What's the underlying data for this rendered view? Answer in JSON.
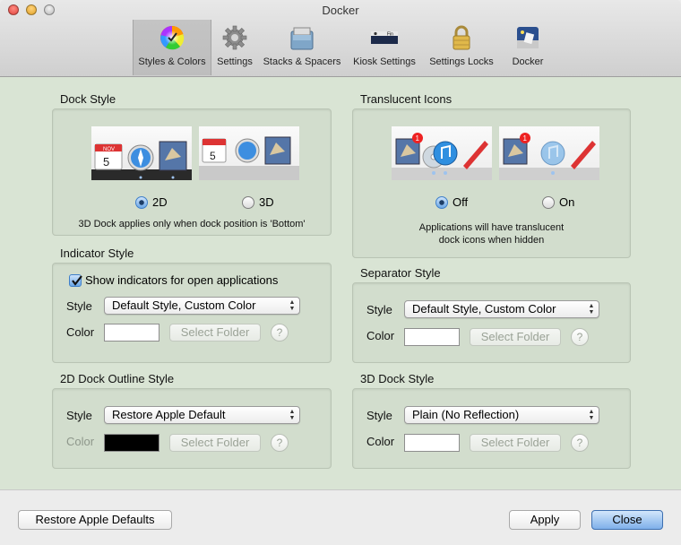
{
  "window": {
    "title": "Docker"
  },
  "toolbar": {
    "items": [
      {
        "label": "Styles & Colors",
        "icon": "color-wheel-icon",
        "selected": true
      },
      {
        "label": "Settings",
        "icon": "gear-icon",
        "selected": false
      },
      {
        "label": "Stacks & Spacers",
        "icon": "stacks-icon",
        "selected": false
      },
      {
        "label": "Kiosk Settings",
        "icon": "kiosk-menubar-icon",
        "selected": false
      },
      {
        "label": "Settings Locks",
        "icon": "padlock-icon",
        "selected": false
      },
      {
        "label": "Docker",
        "icon": "docker-app-icon",
        "selected": false
      }
    ],
    "kiosk_icon_text": "Fin"
  },
  "dock_style": {
    "title": "Dock Style",
    "options": [
      {
        "label": "2D",
        "selected": true
      },
      {
        "label": "3D",
        "selected": false
      }
    ],
    "note": "3D Dock applies only when dock position is 'Bottom'",
    "calendar_month": "NOV",
    "calendar_day": "5"
  },
  "translucent_icons": {
    "title": "Translucent Icons",
    "options": [
      {
        "label": "Off",
        "selected": true
      },
      {
        "label": "On",
        "selected": false
      }
    ],
    "note_line1": "Applications will have translucent",
    "note_line2": "dock icons when hidden",
    "badge": "1"
  },
  "indicator_style": {
    "title": "Indicator Style",
    "checkbox_label": "Show indicators for open applications",
    "checked": true,
    "style_label": "Style",
    "style_value": "Default Style, Custom Color",
    "color_label": "Color",
    "color_value": "#ffffff",
    "select_folder": "Select Folder",
    "help": "?"
  },
  "separator_style": {
    "title": "Separator Style",
    "style_label": "Style",
    "style_value": "Default Style, Custom Color",
    "color_label": "Color",
    "color_value": "#ffffff",
    "select_folder": "Select Folder",
    "help": "?"
  },
  "outline_style": {
    "title": "2D Dock Outline Style",
    "style_label": "Style",
    "style_value": "Restore Apple Default",
    "color_label": "Color",
    "color_value": "#000000",
    "select_folder": "Select Folder",
    "help": "?"
  },
  "dock3d_style": {
    "title": "3D Dock Style",
    "style_label": "Style",
    "style_value": "Plain (No Reflection)",
    "color_label": "Color",
    "color_value": "#ffffff",
    "select_folder": "Select Folder",
    "help": "?"
  },
  "footer": {
    "restore_label": "Restore Apple Defaults",
    "apply_label": "Apply",
    "close_label": "Close"
  }
}
